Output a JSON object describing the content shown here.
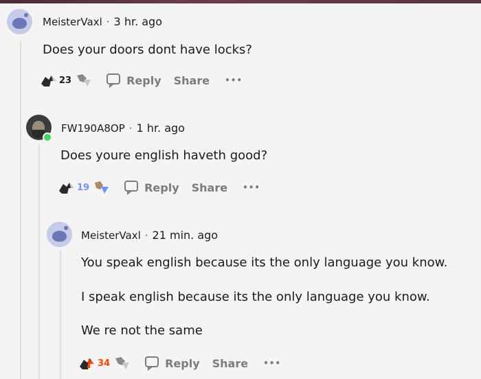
{
  "comments": [
    {
      "username": "MeisterVaxl",
      "separator": "·",
      "time": "3 hr. ago",
      "lines": [
        "Does your doors dont have locks?"
      ],
      "score": "23",
      "score_color": "#1c1c1c",
      "reply_label": "Reply",
      "share_label": "Share",
      "more_label": "•••",
      "avatar": "snoo-avatar"
    },
    {
      "username": "FW190A8OP",
      "separator": "·",
      "time": "1 hr. ago",
      "lines": [
        "Does youre english haveth good?"
      ],
      "score": "19",
      "score_color": "#7193ff",
      "reply_label": "Reply",
      "share_label": "Share",
      "more_label": "•••",
      "avatar": "photo-avatar"
    },
    {
      "username": "MeisterVaxl",
      "separator": "·",
      "time": "21 min. ago",
      "lines": [
        "You speak english because its the only language you know.",
        "I speak english because its the only language you know.",
        "We re not the same"
      ],
      "score": "34",
      "score_color": "#ff4500",
      "reply_label": "Reply",
      "share_label": "Share",
      "more_label": "•••",
      "avatar": "snoo-avatar"
    }
  ]
}
